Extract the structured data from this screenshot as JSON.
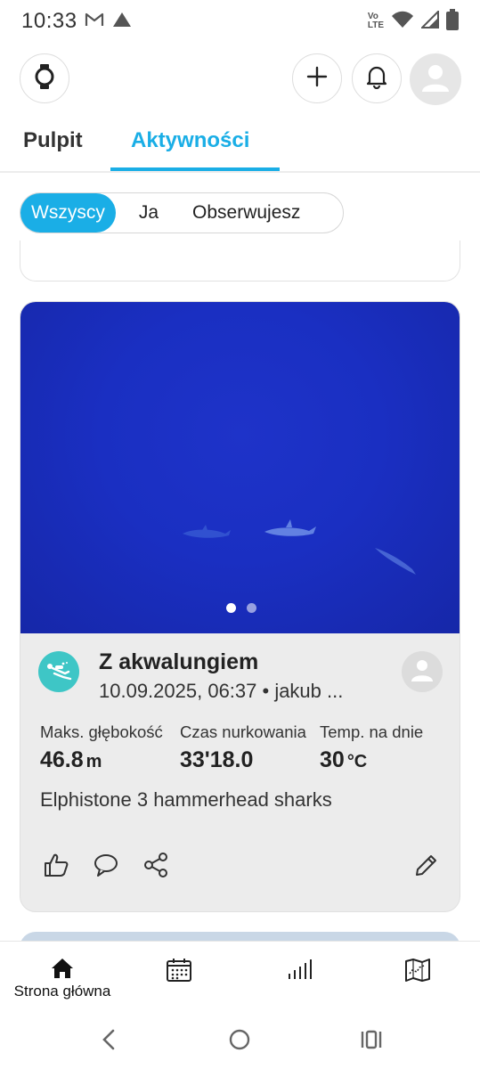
{
  "status_bar": {
    "time": "10:33",
    "icons": [
      "gmail-icon",
      "drive-icon",
      "volte-icon",
      "wifi-icon",
      "signal-icon",
      "battery-icon"
    ],
    "volte_label_1": "Vo",
    "volte_label_2": "LTE"
  },
  "header": {
    "icons": [
      "watch-icon",
      "plus-icon",
      "bell-icon",
      "profile-avatar-icon"
    ]
  },
  "tabs": [
    {
      "label": "Pulpit",
      "active": false
    },
    {
      "label": "Aktywności",
      "active": true
    }
  ],
  "filters": {
    "options": [
      "Wszyscy",
      "Ja",
      "Obserwujesz"
    ],
    "selected": "Wszyscy"
  },
  "card": {
    "photo_pages": 2,
    "photo_current": 1,
    "activity_icon": "scuba-diving-icon",
    "title": "Z akwalungiem",
    "meta": "10.09.2025, 06:37 • jakub ...",
    "stats": [
      {
        "label": "Maks. głębokość",
        "value": "46.8",
        "unit": "m"
      },
      {
        "label": "Czas nurkowania",
        "value": "33'18.0",
        "unit": ""
      },
      {
        "label": "Temp. na dnie",
        "value": "30",
        "unit": "°C"
      }
    ],
    "description": "Elphistone 3 hammerhead sharks",
    "actions": [
      "thumbs-up-icon",
      "comment-icon",
      "share-icon",
      "edit-icon"
    ]
  },
  "bottom_nav": {
    "items": [
      {
        "label": "Strona główna",
        "icon": "home-icon",
        "active": true
      },
      {
        "label": "",
        "icon": "calendar-icon"
      },
      {
        "label": "",
        "icon": "stats-bars-icon"
      },
      {
        "label": "",
        "icon": "map-icon"
      }
    ]
  },
  "colors": {
    "accent": "#1aaee6",
    "activity": "#3ec6c6",
    "photo_blue": "#1a2fc2",
    "card_bg": "#ececec"
  }
}
